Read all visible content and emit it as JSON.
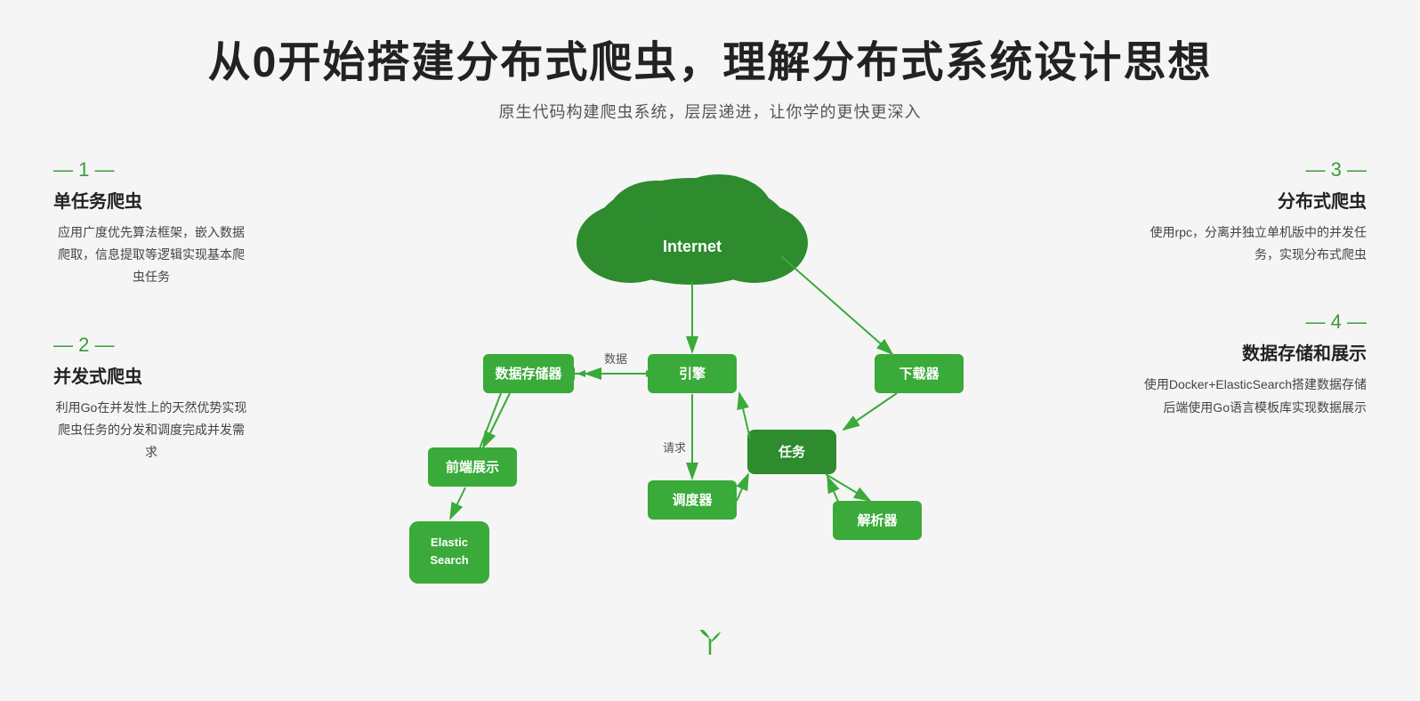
{
  "header": {
    "main_title": "从0开始搭建分布式爬虫，理解分布式系统设计思想",
    "subtitle": "原生代码构建爬虫系统，层层递进，让你学的更快更深入"
  },
  "left_panel": {
    "section1": {
      "number": "1",
      "title": "单任务爬虫",
      "desc": "应用广度优先算法框架，嵌入数据爬取，信息提取等逻辑实现基本爬虫任务"
    },
    "section2": {
      "number": "2",
      "title": "并发式爬虫",
      "desc": "利用Go在并发性上的天然优势实现爬虫任务的分发和调度完成并发需求"
    }
  },
  "right_panel": {
    "section3": {
      "number": "3",
      "title": "分布式爬虫",
      "desc": "使用rpc，分离并独立单机版中的并发任务，实现分布式爬虫"
    },
    "section4": {
      "number": "4",
      "title": "数据存储和展示",
      "desc": "使用Docker+ElasticSearch搭建数据存储后端使用Go语言模板库实现数据展示"
    }
  },
  "diagram": {
    "internet_label": "Internet",
    "nodes": {
      "qianduan": "前端展示",
      "shujucunchu": "数据存储器",
      "yinqing": "引擎",
      "xiaozaiq": "下载器",
      "renwu": "任务",
      "diaoduzhe": "调度器",
      "jiexi": "解析器",
      "elastic": "Elastic\nSearch"
    },
    "labels": {
      "data": "数据",
      "request": "请求"
    }
  },
  "colors": {
    "green": "#3aaa3a",
    "dark_green": "#2e8b2e",
    "accent": "#3aaa3a"
  }
}
